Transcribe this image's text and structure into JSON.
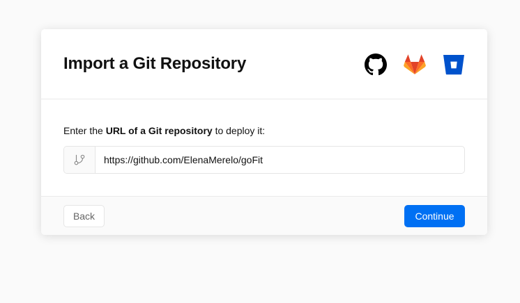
{
  "header": {
    "title": "Import a Git Repository",
    "providers": [
      {
        "name": "GitHub",
        "icon": "github-icon",
        "color": "#000000"
      },
      {
        "name": "GitLab",
        "icon": "gitlab-icon",
        "color": "#fc6d26"
      },
      {
        "name": "Bitbucket",
        "icon": "bitbucket-icon",
        "color": "#0052cc"
      }
    ]
  },
  "body": {
    "instruction_prefix": "Enter the ",
    "instruction_bold": "URL of a Git repository",
    "instruction_suffix": " to deploy it:",
    "url_value": "https://github.com/ElenaMerelo/goFit",
    "url_icon": "git-branch-icon"
  },
  "footer": {
    "back_label": "Back",
    "continue_label": "Continue",
    "accent_color": "#0070f3"
  }
}
